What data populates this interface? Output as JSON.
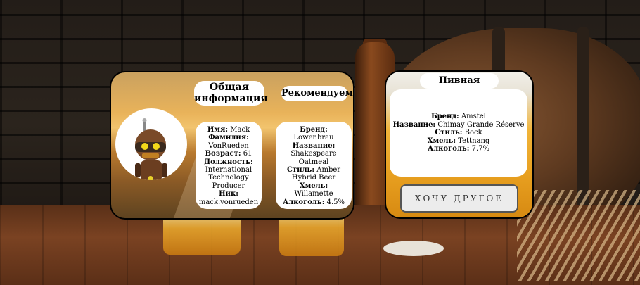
{
  "general": {
    "title": "Общая информация",
    "name_label": "Имя:",
    "name": "Mack",
    "surname_label": "Фамилия:",
    "surname": "VonRueden",
    "age_label": "Возраст:",
    "age": "61",
    "position_label": "Должность:",
    "position": "International Technology Producer",
    "nick_label": "Ник:",
    "nick": "mack.vonrueden"
  },
  "recommend": {
    "title": "Рекомендуем",
    "brand_label": "Бренд:",
    "brand": "Lowenbrau",
    "name_label": "Название:",
    "name": "Shakespeare Oatmeal",
    "style_label": "Стиль:",
    "style": "Amber Hybrid Beer",
    "hops_label": "Хмель:",
    "hops": "Willamette",
    "alcohol_label": "Алкоголь:",
    "alcohol": "4.5%"
  },
  "roulette": {
    "title": "Пивная рулетка",
    "brand_label": "Бренд:",
    "brand": "Amstel",
    "name_label": "Название:",
    "name": "Chimay Grande Réserve",
    "style_label": "Стиль:",
    "style": "Bock",
    "hops_label": "Хмель:",
    "hops": "Tettnang",
    "alcohol_label": "Алкоголь:",
    "alcohol": "7.7%",
    "button_label": "ХОЧУ ДРУГОЕ"
  },
  "icons": {
    "avatar": "robot-avatar-icon"
  }
}
